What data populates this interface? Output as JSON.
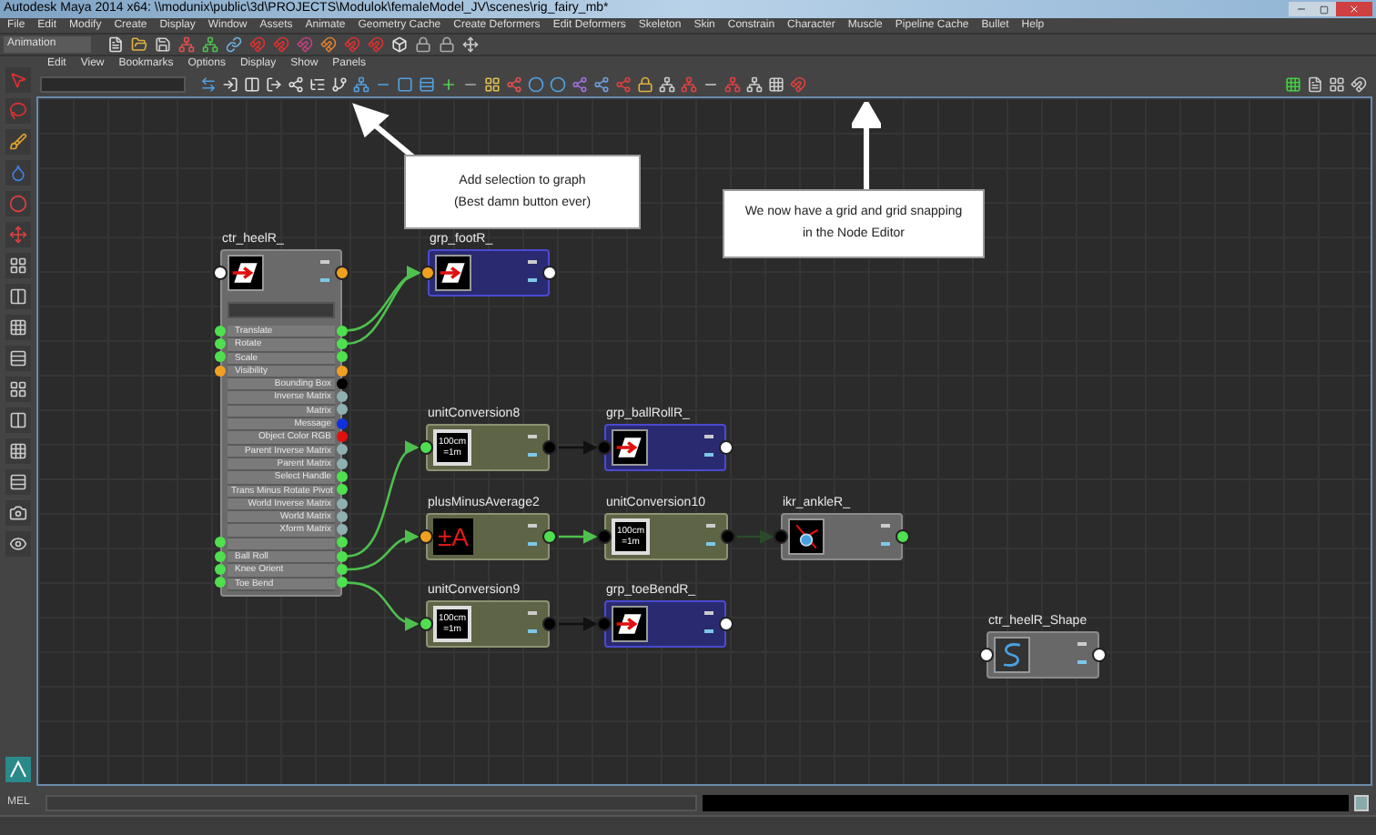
{
  "window": {
    "title": "Autodesk Maya 2014 x64: \\\\modunix\\public\\3d\\PROJECTS\\Modulok\\femaleModel_JV\\scenes\\rig_fairy_mb*"
  },
  "menu_bar": [
    "File",
    "Edit",
    "Modify",
    "Create",
    "Display",
    "Window",
    "Assets",
    "Animate",
    "Geometry Cache",
    "Create Deformers",
    "Edit Deformers",
    "Skeleton",
    "Skin",
    "Constrain",
    "Character",
    "Muscle",
    "Pipeline Cache",
    "Bullet",
    "Help"
  ],
  "shelf": {
    "mode": "Animation"
  },
  "node_editor": {
    "menu": [
      "Edit",
      "View",
      "Bookmarks",
      "Options",
      "Display",
      "Show",
      "Panels"
    ],
    "nodes": [
      {
        "name": "ctr_heelR_",
        "kind": "control",
        "ports": [
          {
            "kind": "input",
            "color": "#ffffff"
          },
          {
            "kind": "output",
            "color": "#f0a020"
          }
        ],
        "attributes": [
          {
            "label": "Translate",
            "kind": "io",
            "color": "#4ee04e"
          },
          {
            "label": "Rotate",
            "kind": "io",
            "color": "#4ee04e"
          },
          {
            "label": "Scale",
            "kind": "io",
            "color": "#4ee04e"
          },
          {
            "label": "Visibility",
            "kind": "io",
            "color": "#f0a020"
          },
          {
            "label": "Bounding Box",
            "kind": "output",
            "color": "#000000"
          },
          {
            "label": "Inverse Matrix",
            "kind": "output",
            "color": "#8fb0b0"
          },
          {
            "label": "Matrix",
            "kind": "output",
            "color": "#8fb0b0"
          },
          {
            "label": "Message",
            "kind": "output",
            "color": "#1030e0"
          },
          {
            "label": "Object Color RGB",
            "kind": "output",
            "color": "#e01010"
          },
          {
            "label": "Parent Inverse Matrix",
            "kind": "output",
            "color": "#8fb0b0"
          },
          {
            "label": "Parent Matrix",
            "kind": "output",
            "color": "#8fb0b0"
          },
          {
            "label": "Select Handle",
            "kind": "output",
            "color": "#4ee04e"
          },
          {
            "label": "Trans Minus Rotate Pivot",
            "kind": "output",
            "color": "#4ee04e"
          },
          {
            "label": "World Inverse Matrix",
            "kind": "output",
            "color": "#8fb0b0"
          },
          {
            "label": "World Matrix",
            "kind": "output",
            "color": "#8fb0b0"
          },
          {
            "label": "Xform Matrix",
            "kind": "output",
            "color": "#8fb0b0"
          },
          {
            "kind": "io",
            "color": "#4ee04e"
          },
          {
            "label": "Ball Roll",
            "kind": "io",
            "color": "#4ee04e"
          },
          {
            "label": "Knee Orient",
            "kind": "io",
            "color": "#4ee04e"
          },
          {
            "label": "Toe Bend",
            "kind": "io",
            "color": "#4ee04e"
          }
        ]
      },
      {
        "name": "grp_footR_",
        "kind": "group",
        "ports": [
          {
            "kind": "input",
            "color": "#f0a020"
          },
          {
            "kind": "output",
            "color": "#ffffff"
          }
        ]
      },
      {
        "name": "unitConversion8",
        "kind": "conversion",
        "icon_label": "100cm =1m",
        "ports": [
          {
            "kind": "input",
            "color": "#4ee04e"
          },
          {
            "kind": "output",
            "color": "#000000"
          }
        ]
      },
      {
        "name": "grp_ballRollR_",
        "kind": "group",
        "ports": [
          {
            "kind": "input",
            "color": "#000000"
          },
          {
            "kind": "output",
            "color": "#ffffff"
          }
        ]
      },
      {
        "name": "plusMinusAverage2",
        "kind": "math",
        "icon_label": "±A",
        "ports": [
          {
            "kind": "input",
            "color": "#f0a020"
          },
          {
            "kind": "output",
            "color": "#4ee04e"
          }
        ]
      },
      {
        "name": "unitConversion10",
        "kind": "conversion",
        "icon_label": "100cm =1m",
        "ports": [
          {
            "kind": "input",
            "color": "#000000"
          },
          {
            "kind": "output",
            "color": "#000000"
          }
        ]
      },
      {
        "name": "ikr_ankleR_",
        "kind": "joint",
        "ports": [
          {
            "kind": "input",
            "color": "#000000"
          },
          {
            "kind": "output",
            "color": "#4ee04e"
          }
        ]
      },
      {
        "name": "unitConversion9",
        "kind": "conversion",
        "icon_label": "100cm =1m",
        "ports": [
          {
            "kind": "input",
            "color": "#4ee04e"
          },
          {
            "kind": "output",
            "color": "#000000"
          }
        ]
      },
      {
        "name": "grp_toeBendR_",
        "kind": "group",
        "ports": [
          {
            "kind": "input",
            "color": "#000000"
          },
          {
            "kind": "output",
            "color": "#ffffff"
          }
        ]
      },
      {
        "name": "ctr_heelR_Shape",
        "kind": "shape",
        "ports": [
          {
            "kind": "input",
            "color": "#ffffff"
          },
          {
            "kind": "output",
            "color": "#ffffff"
          }
        ]
      }
    ]
  },
  "callouts": [
    {
      "lines": [
        "Add selection to graph",
        "(Best damn button ever)"
      ]
    },
    {
      "lines": [
        "We now have a grid and grid snapping",
        "in the Node Editor"
      ]
    }
  ],
  "command_line": {
    "label": "MEL"
  }
}
